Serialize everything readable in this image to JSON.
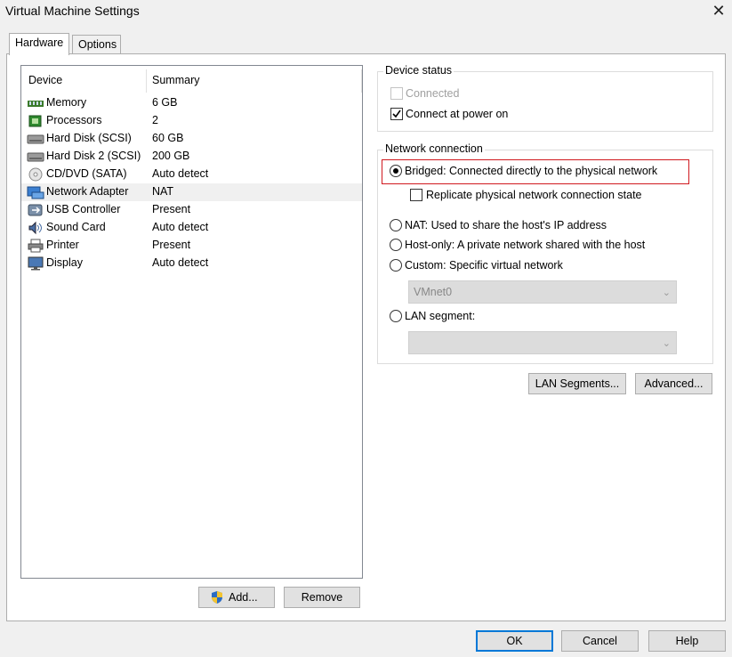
{
  "window": {
    "title": "Virtual Machine Settings"
  },
  "tabs": [
    {
      "label": "Hardware",
      "active": true
    },
    {
      "label": "Options",
      "active": false
    }
  ],
  "device_list": {
    "headers": {
      "device": "Device",
      "summary": "Summary"
    },
    "rows": [
      {
        "name": "Memory",
        "summary": "6 GB",
        "icon": "memory-icon"
      },
      {
        "name": "Processors",
        "summary": "2",
        "icon": "processor-icon"
      },
      {
        "name": "Hard Disk (SCSI)",
        "summary": "60 GB",
        "icon": "hard-disk-icon"
      },
      {
        "name": "Hard Disk 2 (SCSI)",
        "summary": "200 GB",
        "icon": "hard-disk-icon"
      },
      {
        "name": "CD/DVD (SATA)",
        "summary": "Auto detect",
        "icon": "cd-dvd-icon"
      },
      {
        "name": "Network Adapter",
        "summary": "NAT",
        "icon": "network-adapter-icon",
        "selected": true
      },
      {
        "name": "USB Controller",
        "summary": "Present",
        "icon": "usb-icon"
      },
      {
        "name": "Sound Card",
        "summary": "Auto detect",
        "icon": "sound-card-icon"
      },
      {
        "name": "Printer",
        "summary": "Present",
        "icon": "printer-icon"
      },
      {
        "name": "Display",
        "summary": "Auto detect",
        "icon": "display-icon"
      }
    ]
  },
  "list_buttons": {
    "add": "Add...",
    "remove": "Remove"
  },
  "device_status": {
    "title": "Device status",
    "connected": {
      "label": "Connected",
      "checked": false,
      "enabled": false
    },
    "connect_at_power_on": {
      "label": "Connect at power on",
      "checked": true
    }
  },
  "network_connection": {
    "title": "Network connection",
    "bridged": {
      "label": "Bridged: Connected directly to the physical network",
      "selected": true
    },
    "replicate": {
      "label": "Replicate physical network connection state",
      "checked": false
    },
    "nat": {
      "label": "NAT: Used to share the host's IP address"
    },
    "host_only": {
      "label": "Host-only: A private network shared with the host"
    },
    "custom": {
      "label": "Custom: Specific virtual network"
    },
    "custom_select": {
      "value": "VMnet0"
    },
    "lan_segment": {
      "label": "LAN segment:"
    },
    "lan_select": {
      "value": ""
    }
  },
  "action_buttons": {
    "lan_segments": "LAN Segments...",
    "advanced": "Advanced..."
  },
  "dialog_buttons": {
    "ok": "OK",
    "cancel": "Cancel",
    "help": "Help"
  },
  "colors": {
    "highlight": "#d0191f",
    "default_button": "#0078d7"
  }
}
